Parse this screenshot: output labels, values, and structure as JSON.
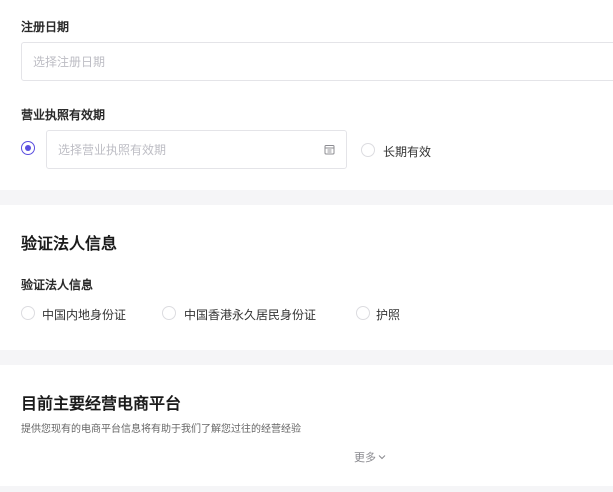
{
  "registration": {
    "date_label": "注册日期",
    "date_placeholder": "选择注册日期",
    "license_label": "营业执照有效期",
    "license_placeholder": "选择营业执照有效期",
    "long_term_label": "长期有效",
    "license_mode_selected": "date-range"
  },
  "legal": {
    "section_title": "验证法人信息",
    "field_label": "验证法人信息",
    "options": [
      "中国内地身份证",
      "中国香港永久居民身份证",
      "护照"
    ]
  },
  "platform": {
    "section_title": "目前主要经营电商平台",
    "hint": "提供您现有的电商平台信息将有助于我们了解您过往的经营经验",
    "more_label": "更多"
  },
  "colors": {
    "accent": "#5a4ee0",
    "background": "#f5f5f7",
    "border": "#e4e4e8",
    "placeholder": "#bdbdc4"
  },
  "icons": [
    "calendar-icon",
    "chevron-down-icon"
  ]
}
